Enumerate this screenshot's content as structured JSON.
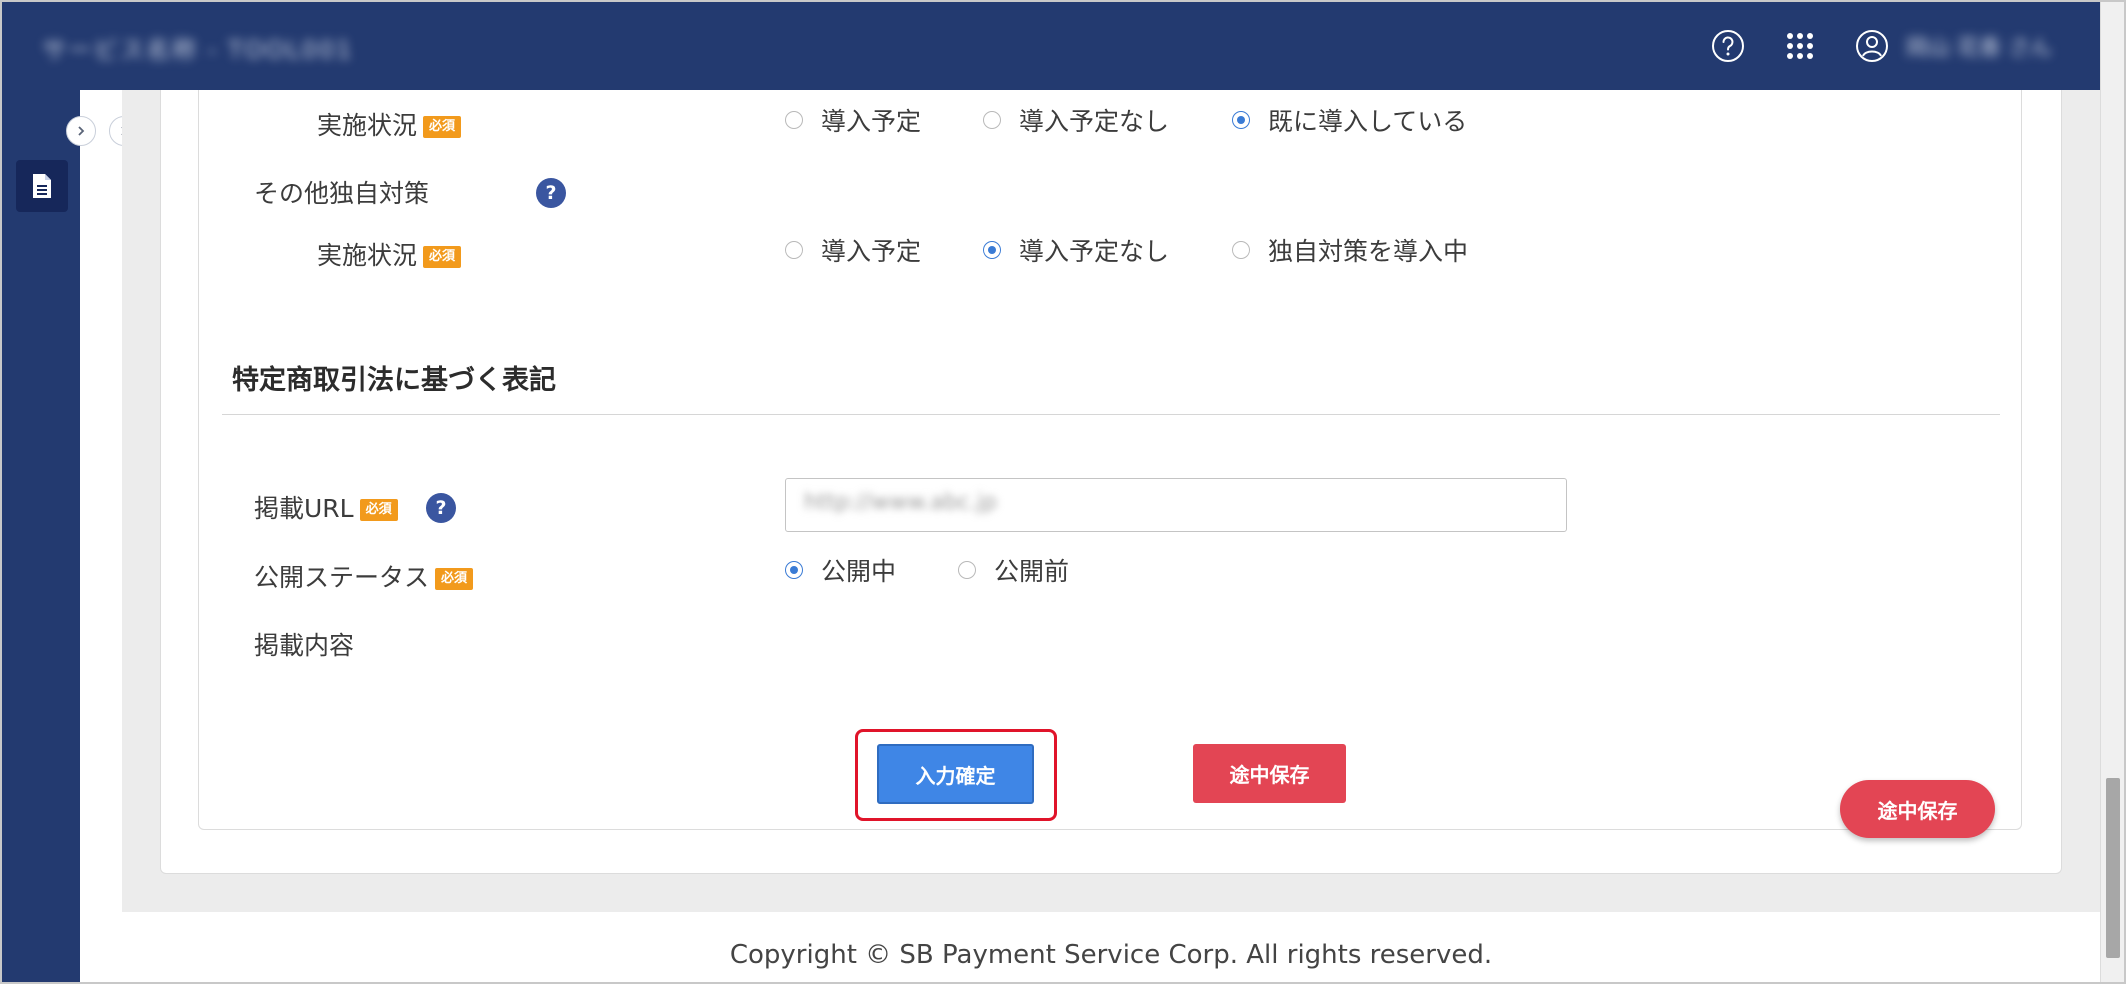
{
  "header": {
    "app_title": "サービス名称 - TOOL001",
    "user_name": "岡山 花香 さん",
    "icons": [
      "help-circle-icon",
      "app-grid-icon",
      "user-account-icon"
    ]
  },
  "sidebar": {
    "document_icon": "document-icon",
    "expand_icons": [
      "chevron-right-icon",
      "chevron-right-icon"
    ]
  },
  "required_badge": "必須",
  "help_glyph": "?",
  "rows": {
    "status1": {
      "label": "実施状況",
      "options": [
        "導入予定",
        "導入予定なし",
        "既に導入している"
      ],
      "selected": "既に導入している"
    },
    "other": {
      "label": "その他独自対策"
    },
    "status2": {
      "label": "実施状況",
      "options": [
        "導入予定",
        "導入予定なし",
        "独自対策を導入中"
      ],
      "selected": "導入予定なし"
    }
  },
  "section": {
    "title": "特定商取引法に基づく表記"
  },
  "url": {
    "label": "掲載URL",
    "value": "http://www.abc.jp"
  },
  "publish": {
    "label": "公開ステータス",
    "options": [
      "公開中",
      "公開前"
    ],
    "selected": "公開中"
  },
  "content_label": "掲載内容",
  "buttons": {
    "confirm": "入力確定",
    "save": "途中保存",
    "float_save": "途中保存"
  },
  "footer": {
    "copyright": "Copyright © SB Payment Service Corp. All rights reserved."
  },
  "colors": {
    "header_bg": "#233a70",
    "primary": "#3f86e6",
    "danger": "#e34554",
    "required": "#f29a1c",
    "highlight": "#e0142a"
  }
}
